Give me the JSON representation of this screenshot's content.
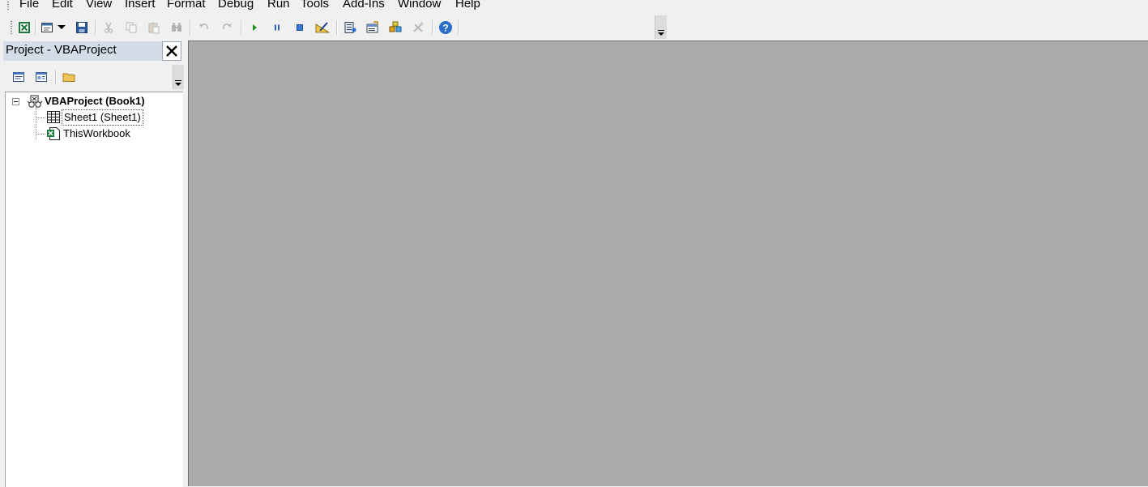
{
  "menu": {
    "items": [
      {
        "label": "File",
        "id": "file"
      },
      {
        "label": "Edit",
        "id": "edit"
      },
      {
        "label": "View",
        "id": "view"
      },
      {
        "label": "Insert",
        "id": "insert"
      },
      {
        "label": "Format",
        "id": "format"
      },
      {
        "label": "Debug",
        "id": "debug"
      },
      {
        "label": "Run",
        "id": "run"
      },
      {
        "label": "Tools",
        "id": "tools"
      },
      {
        "label": "Add-Ins",
        "id": "addins"
      },
      {
        "label": "Window",
        "id": "window"
      },
      {
        "label": "Help",
        "id": "help"
      }
    ]
  },
  "toolbar": {
    "buttons": [
      {
        "icon": "excel-icon",
        "enabled": true
      },
      {
        "icon": "insert-userform-icon",
        "enabled": true
      },
      {
        "icon": "dropdown-arrow-icon",
        "enabled": true
      },
      {
        "icon": "save-icon",
        "enabled": true
      },
      {
        "icon": "cut-icon",
        "enabled": false
      },
      {
        "icon": "copy-icon",
        "enabled": false
      },
      {
        "icon": "paste-icon",
        "enabled": false
      },
      {
        "icon": "find-icon",
        "enabled": false
      },
      {
        "icon": "undo-icon",
        "enabled": false
      },
      {
        "icon": "redo-icon",
        "enabled": false
      },
      {
        "icon": "run-icon",
        "enabled": true
      },
      {
        "icon": "break-icon",
        "enabled": true
      },
      {
        "icon": "reset-icon",
        "enabled": true
      },
      {
        "icon": "design-mode-icon",
        "enabled": true
      },
      {
        "icon": "project-explorer-icon",
        "enabled": true
      },
      {
        "icon": "properties-window-icon",
        "enabled": true
      },
      {
        "icon": "object-browser-icon",
        "enabled": true
      },
      {
        "icon": "toolbox-icon",
        "enabled": false
      },
      {
        "icon": "help-icon",
        "enabled": true
      }
    ]
  },
  "project_pane": {
    "title": "Project - VBAProject",
    "toolbar": [
      "view-code-icon",
      "view-object-icon",
      "toggle-folders-icon"
    ],
    "tree": {
      "root": {
        "label": "VBAProject (Book1)",
        "icon": "vba-project-icon",
        "expanded": true
      },
      "children": [
        {
          "label": "Sheet1 (Sheet1)",
          "icon": "worksheet-icon",
          "selected": true
        },
        {
          "label": "ThisWorkbook",
          "icon": "workbook-icon",
          "selected": false
        }
      ]
    }
  },
  "colors": {
    "chrome_bg": "#f0f0f0",
    "mdi_bg": "#ababab",
    "pane_title_bg": "#d3dde8",
    "help_blue": "#2a6ec9",
    "run_green": "#1a8f1a"
  }
}
